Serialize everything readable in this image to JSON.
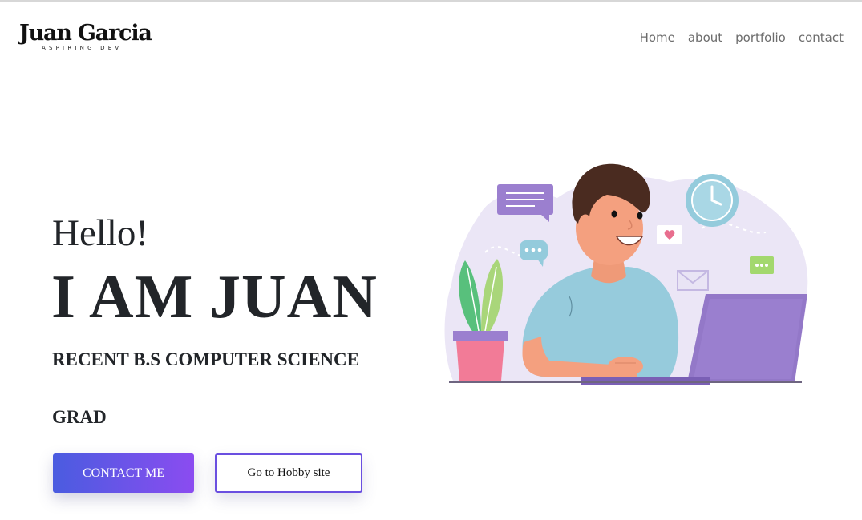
{
  "brand": {
    "name": "Juan Garcia",
    "tagline": "ASPIRING DEV"
  },
  "nav": {
    "items": [
      {
        "label": "Home"
      },
      {
        "label": "about"
      },
      {
        "label": "portfolio"
      },
      {
        "label": "contact"
      }
    ]
  },
  "hero": {
    "greeting": "Hello!",
    "headline": "I AM JUAN",
    "subtitle_line1": "RECENT B.S COMPUTER SCIENCE",
    "subtitle_line2": "GRAD",
    "contact_button": "CONTACT ME",
    "hobby_button": "Go to Hobby site"
  },
  "colors": {
    "text": "#222529",
    "nav_text": "#6c6c6c",
    "button_gradient_start": "#4a5ce0",
    "button_gradient_end": "#8b4cf0",
    "outline_button_border": "#6a4fe0"
  },
  "illustration": {
    "icons": [
      "chat-bubble-icon",
      "clock-icon",
      "heart-message-icon",
      "mail-icon",
      "typing-bubble-icon",
      "plant-icon",
      "laptop-icon"
    ]
  }
}
